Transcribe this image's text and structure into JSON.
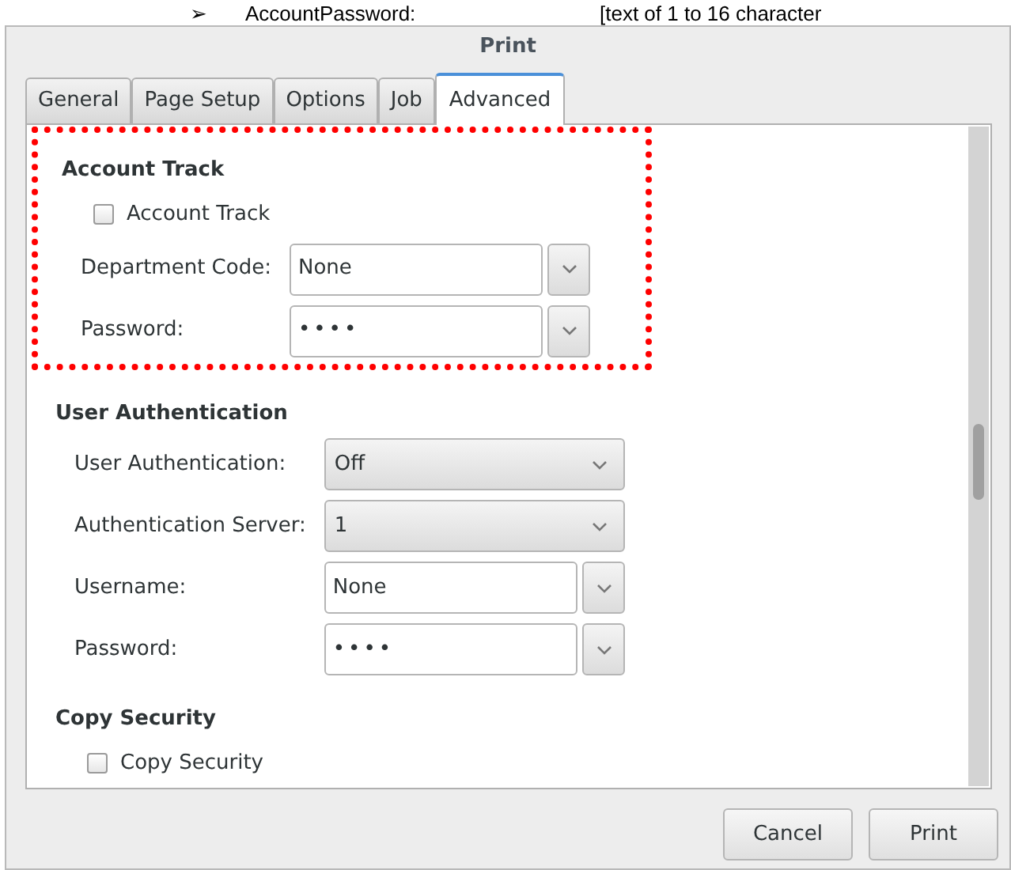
{
  "document_line": {
    "bullet": "➢",
    "label": "AccountPassword:",
    "value": "[text of 1 to 16 character"
  },
  "window": {
    "title": "Print"
  },
  "tabs": [
    {
      "label": "General",
      "selected": false
    },
    {
      "label": "Page Setup",
      "selected": false
    },
    {
      "label": "Options",
      "selected": false
    },
    {
      "label": "Job",
      "selected": false
    },
    {
      "label": "Advanced",
      "selected": true
    }
  ],
  "sections": [
    {
      "heading": "Account Track",
      "highlighted": true,
      "rows": [
        {
          "kind": "checkbox",
          "label": "Account Track",
          "checked": false
        },
        {
          "kind": "entry",
          "label": "Department Code:",
          "value": "None"
        },
        {
          "kind": "entry",
          "label": "Password:",
          "value": "••••"
        }
      ]
    },
    {
      "heading": "User Authentication",
      "highlighted": false,
      "rows": [
        {
          "kind": "combo",
          "label": "User Authentication:",
          "value": "Off"
        },
        {
          "kind": "combo",
          "label": "Authentication Server:",
          "value": "1"
        },
        {
          "kind": "entry",
          "label": "Username:",
          "value": "None"
        },
        {
          "kind": "entry",
          "label": "Password:",
          "value": "••••"
        }
      ]
    },
    {
      "heading": "Copy Security",
      "highlighted": false,
      "rows": [
        {
          "kind": "checkbox",
          "label": "Copy Security",
          "checked": false
        }
      ]
    }
  ],
  "buttons": [
    "Cancel",
    "Print"
  ]
}
